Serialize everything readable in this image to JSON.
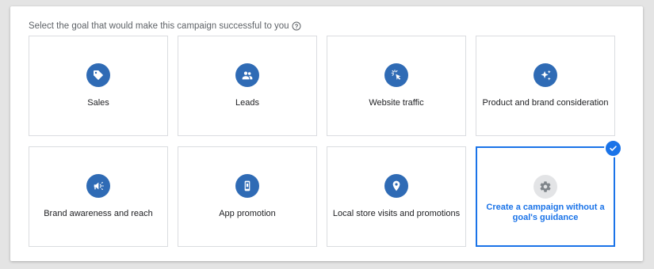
{
  "header": {
    "prompt": "Select the goal that would make this campaign successful to you"
  },
  "goals": [
    {
      "label": "Sales",
      "icon": "tag-icon",
      "selected": false
    },
    {
      "label": "Leads",
      "icon": "people-icon",
      "selected": false
    },
    {
      "label": "Website traffic",
      "icon": "cursor-click-icon",
      "selected": false
    },
    {
      "label": "Product and brand consideration",
      "icon": "sparkle-icon",
      "selected": false
    },
    {
      "label": "Brand awareness and reach",
      "icon": "megaphone-icon",
      "selected": false
    },
    {
      "label": "App promotion",
      "icon": "phone-icon",
      "selected": false
    },
    {
      "label": "Local store visits and promotions",
      "icon": "location-pin-icon",
      "selected": false
    },
    {
      "label": "Create a campaign without a goal's guidance",
      "icon": "gear-icon",
      "selected": true
    }
  ],
  "colors": {
    "accent": "#1a73e8",
    "icon_bg": "#2f6bb5",
    "border": "#dadce0"
  }
}
